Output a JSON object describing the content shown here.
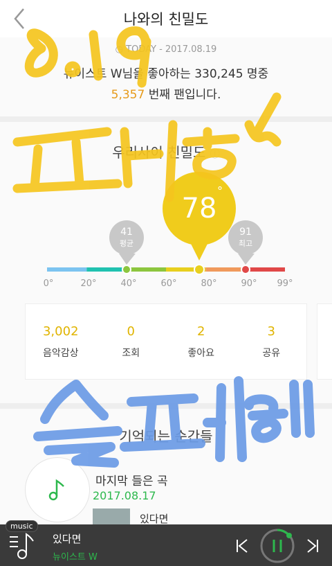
{
  "header": {
    "title": "나와의 친밀도"
  },
  "today": {
    "label": "TODAY - 2017.08.19"
  },
  "fan_info": {
    "line1": "뉴이스트 W님을 좋아하는 330,245 명중",
    "rank": "5,357",
    "line2_suffix": " 번째 팬입니다."
  },
  "intimacy": {
    "section_title": "우리사이 친밀도",
    "current": {
      "value": "78",
      "unit": "°"
    },
    "average": {
      "value": "41",
      "label": "평균"
    },
    "max": {
      "value": "91",
      "label": "최고"
    },
    "ticks": [
      "0°",
      "20°",
      "40°",
      "60°",
      "80°",
      "90°",
      "99°"
    ],
    "gauge_colors": [
      "#7cc4f0",
      "#20c2b0",
      "#8cc63e",
      "#e8cf1e",
      "#f09a5c",
      "#e04848"
    ]
  },
  "stats": [
    {
      "value": "3,002",
      "label": "음악감상"
    },
    {
      "value": "0",
      "label": "조회"
    },
    {
      "value": "2",
      "label": "좋아요"
    },
    {
      "value": "3",
      "label": "공유"
    }
  ],
  "memories": {
    "section_title": "기억되는 순간들",
    "last_song_label": "마지막 들은 곡",
    "last_song_date": "2017.08.17",
    "song_title": "있다면",
    "accent": "#2db84d"
  },
  "player": {
    "tag": "music",
    "song": "있다면",
    "artist": "뉴이스트 W"
  },
  "handwriting": {
    "date": "8.19",
    "line1": "팬된",
    "line2": "슬퍼욧"
  }
}
